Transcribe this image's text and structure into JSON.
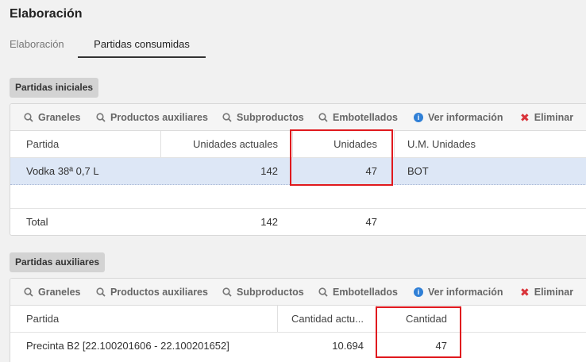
{
  "page": {
    "title": "Elaboración"
  },
  "tabs": [
    {
      "label": "Elaboración",
      "active": false
    },
    {
      "label": "Partidas consumidas",
      "active": true
    }
  ],
  "toolbar": {
    "graneles": "Graneles",
    "productos_auxiliares": "Productos auxiliares",
    "subproductos": "Subproductos",
    "embotellados": "Embotellados",
    "ver_informacion": "Ver información",
    "eliminar": "Eliminar"
  },
  "partidas_iniciales": {
    "label": "Partidas iniciales",
    "columns": [
      "Partida",
      "Unidades actuales",
      "Unidades",
      "U.M. Unidades"
    ],
    "rows": [
      {
        "partida": "Vodka 38ª 0,7 L",
        "unidades_actuales": "142",
        "unidades": "47",
        "um": "BOT"
      }
    ],
    "total": {
      "label": "Total",
      "unidades_actuales": "142",
      "unidades": "47"
    }
  },
  "partidas_auxiliares": {
    "label": "Partidas auxiliares",
    "columns": [
      "Partida",
      "Cantidad actu...",
      "Cantidad"
    ],
    "rows": [
      {
        "partida": "Precinta B2 [22.100201606 - 22.100201652]",
        "cantidad_actual": "10.694",
        "cantidad": "47"
      }
    ]
  },
  "colors": {
    "highlight": "#e0191e",
    "selected_row": "#dde7f6",
    "info": "#2f7fd6",
    "delete": "#d9333a"
  }
}
